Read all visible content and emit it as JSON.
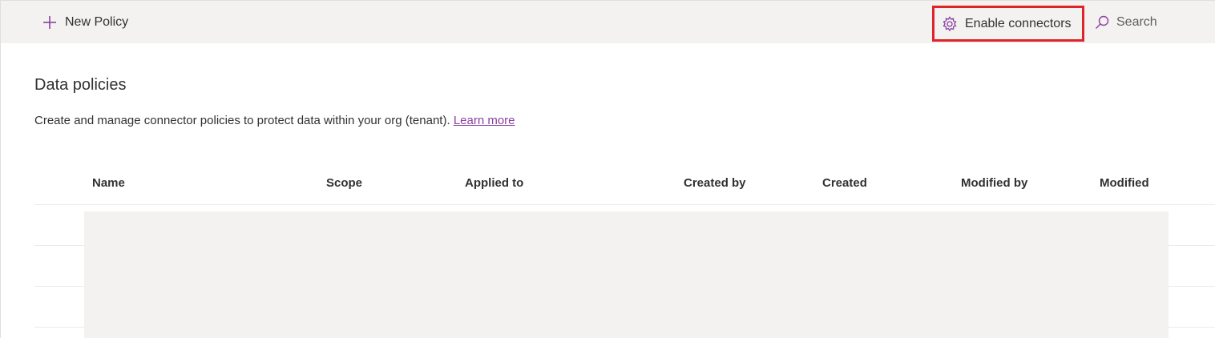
{
  "commandbar": {
    "new_policy_label": "New Policy",
    "enable_connectors_label": "Enable connectors",
    "search_label": "Search"
  },
  "page": {
    "title": "Data policies",
    "description": "Create and manage connector policies to protect data within your org (tenant).",
    "learn_more": "Learn more"
  },
  "table": {
    "columns": [
      "Name",
      "Scope",
      "Applied to",
      "Created by",
      "Created",
      "Modified by",
      "Modified"
    ]
  },
  "colors": {
    "accent": "#8a3fa0",
    "highlight_border": "#e0222a",
    "commandbar_bg": "#f3f2f1"
  },
  "icons": {
    "new_policy": "plus-icon",
    "enable_connectors": "gear-icon",
    "search": "search-icon"
  }
}
